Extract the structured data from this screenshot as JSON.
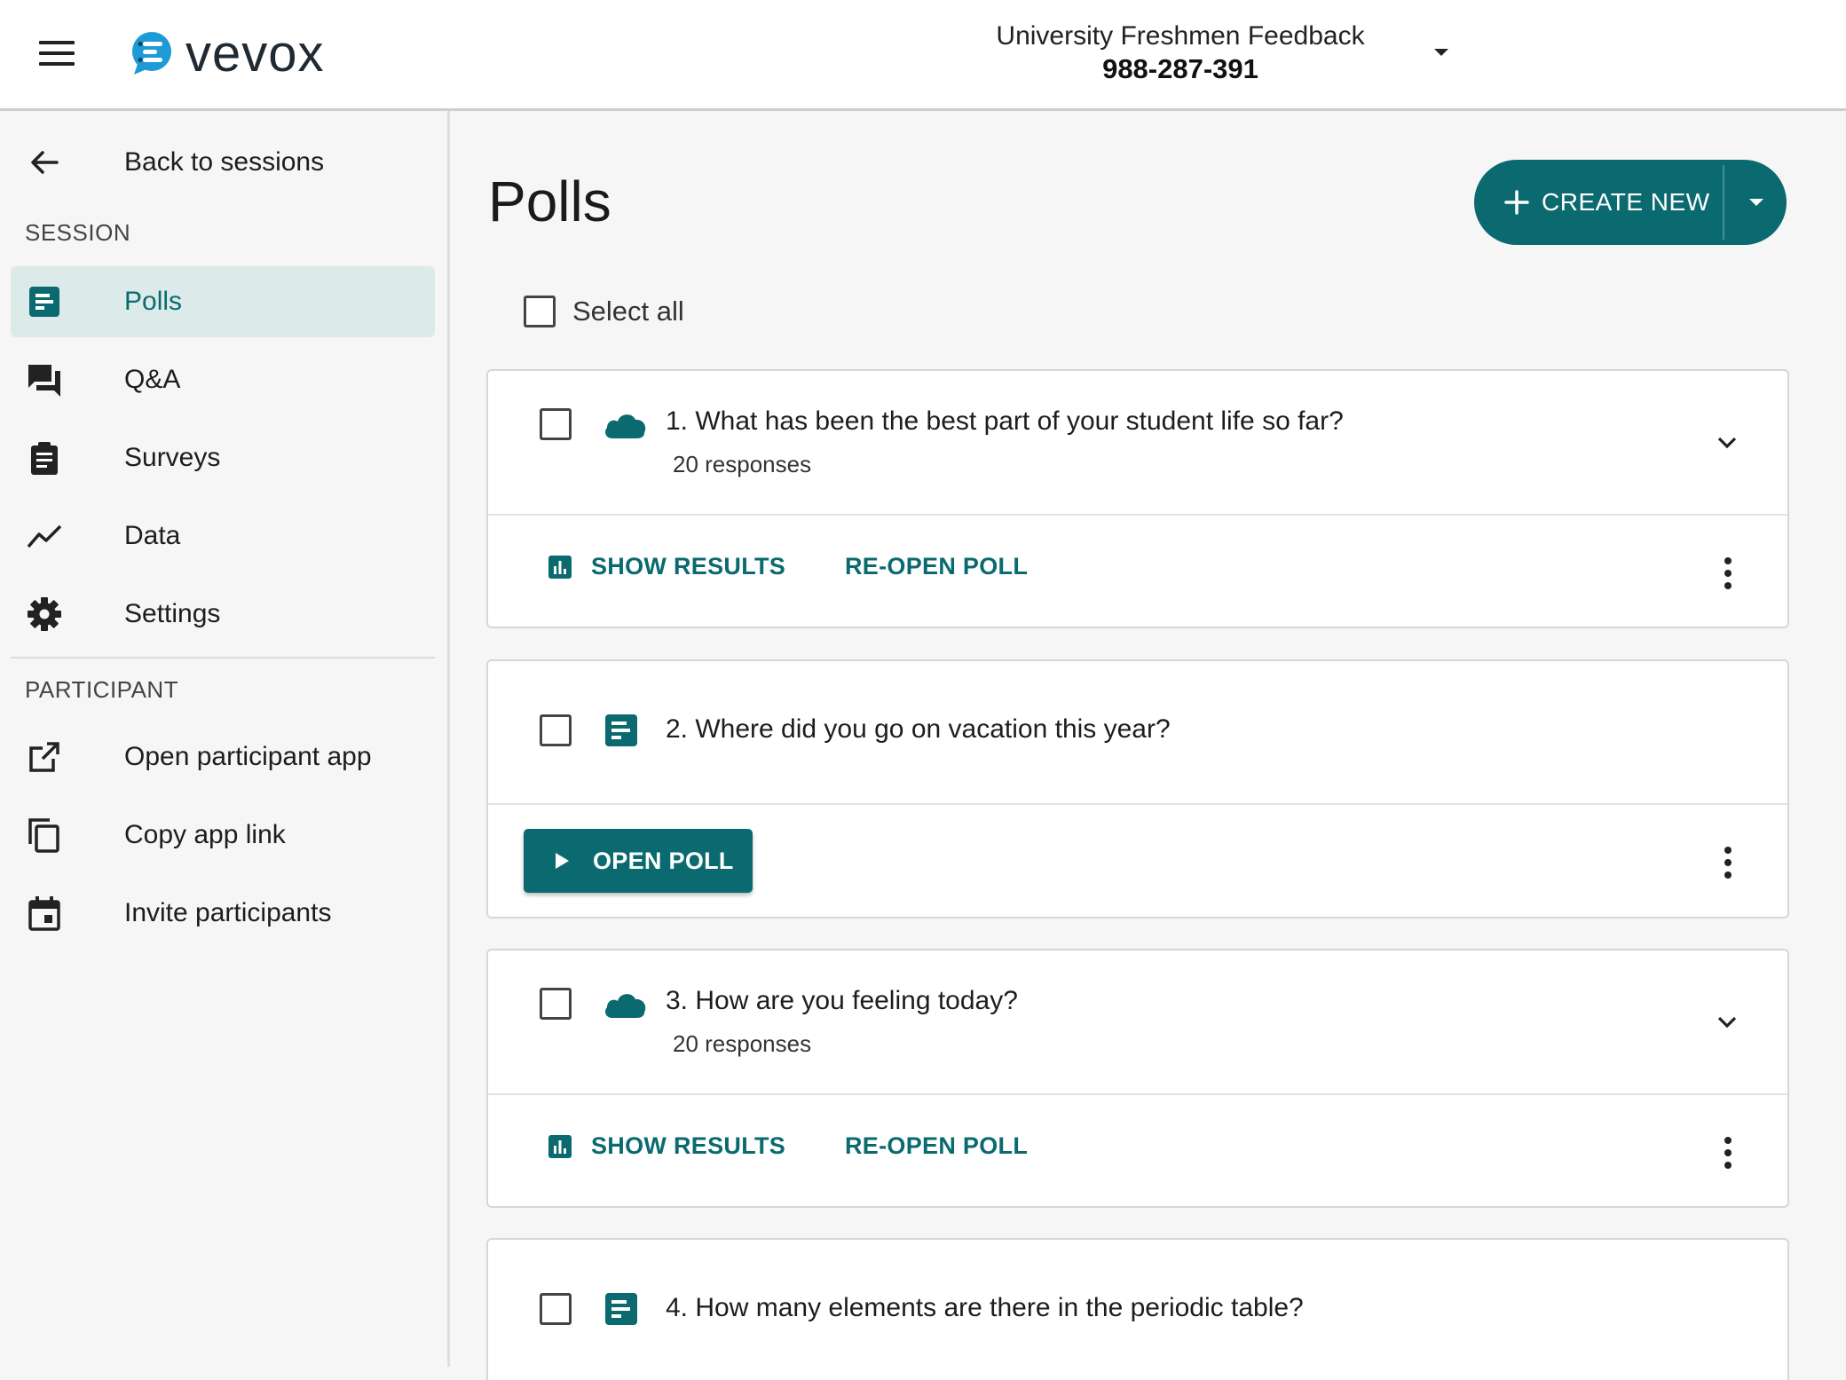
{
  "header": {
    "logo_text": "vevox",
    "session_title": "University Freshmen Feedback",
    "session_code": "988-287-391"
  },
  "sidebar": {
    "back_label": "Back to sessions",
    "session_section": "SESSION",
    "session_items": [
      {
        "label": "Polls",
        "icon": "polls-icon",
        "active": true
      },
      {
        "label": "Q&A",
        "icon": "qa-icon"
      },
      {
        "label": "Surveys",
        "icon": "clipboard-icon"
      },
      {
        "label": "Data",
        "icon": "trend-icon"
      },
      {
        "label": "Settings",
        "icon": "gear-icon"
      }
    ],
    "participant_section": "PARTICIPANT",
    "participant_items": [
      {
        "label": "Open participant app",
        "icon": "external-link-icon"
      },
      {
        "label": "Copy app link",
        "icon": "copy-icon"
      },
      {
        "label": "Invite participants",
        "icon": "calendar-icon"
      }
    ]
  },
  "main": {
    "title": "Polls",
    "create_label": "CREATE NEW",
    "select_all_label": "Select all",
    "polls": [
      {
        "title": "1. What has been the best part of your student life so far?",
        "responses": "20 responses",
        "icon": "cloud-icon",
        "show_results": "SHOW RESULTS",
        "reopen": "RE-OPEN POLL"
      },
      {
        "title": "2. Where did you go on vacation this year?",
        "icon": "text-poll-icon",
        "open": "OPEN POLL"
      },
      {
        "title": "3. How are you feeling today?",
        "responses": "20 responses",
        "icon": "cloud-icon",
        "show_results": "SHOW RESULTS",
        "reopen": "RE-OPEN POLL"
      },
      {
        "title": "4. How many elements are there in the periodic table?",
        "icon": "text-poll-icon"
      }
    ]
  },
  "colors": {
    "accent": "#0b6a6f",
    "active_bg": "#dceaea"
  }
}
